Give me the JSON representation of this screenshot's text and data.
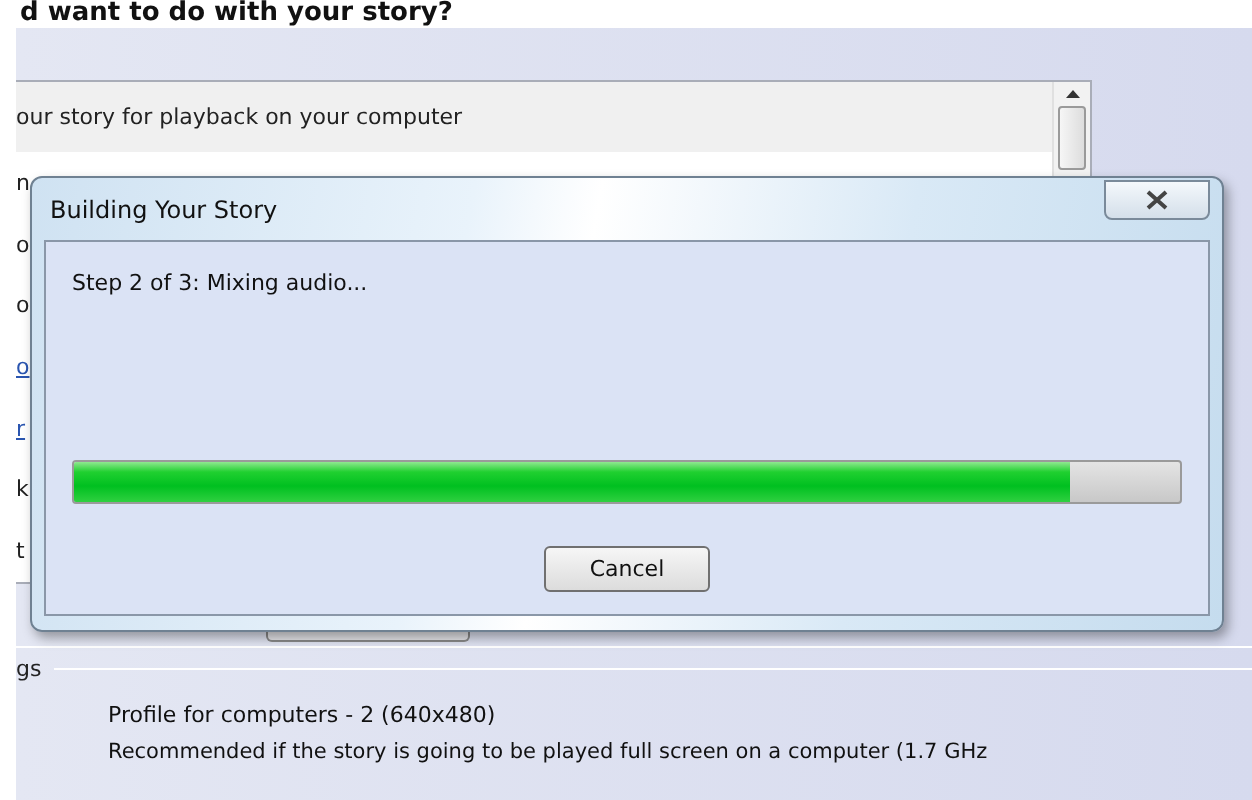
{
  "page": {
    "heading": "d want to do with your story?",
    "options_list": {
      "first_item": "our story for playback on your computer"
    },
    "side_fragments": [
      {
        "text": "n",
        "kind": "plain"
      },
      {
        "text": "o",
        "kind": "plain"
      },
      {
        "text": "o",
        "kind": "plain"
      },
      {
        "text": "o",
        "kind": "link"
      },
      {
        "text": "r",
        "kind": "link"
      },
      {
        "text": "k",
        "kind": "plain"
      },
      {
        "text": "t",
        "kind": "plain"
      }
    ],
    "settings_heading": "gs",
    "profile": "Profile for computers - 2 (640x480)",
    "profile_description": "Recommended if the story is going to be played full screen on a computer (1.7 GHz"
  },
  "dialog": {
    "title": "Building Your Story",
    "status": "Step 2 of 3: Mixing audio...",
    "progress": {
      "level": 0.9
    },
    "buttons": [
      {
        "label": "Cancel"
      }
    ]
  }
}
